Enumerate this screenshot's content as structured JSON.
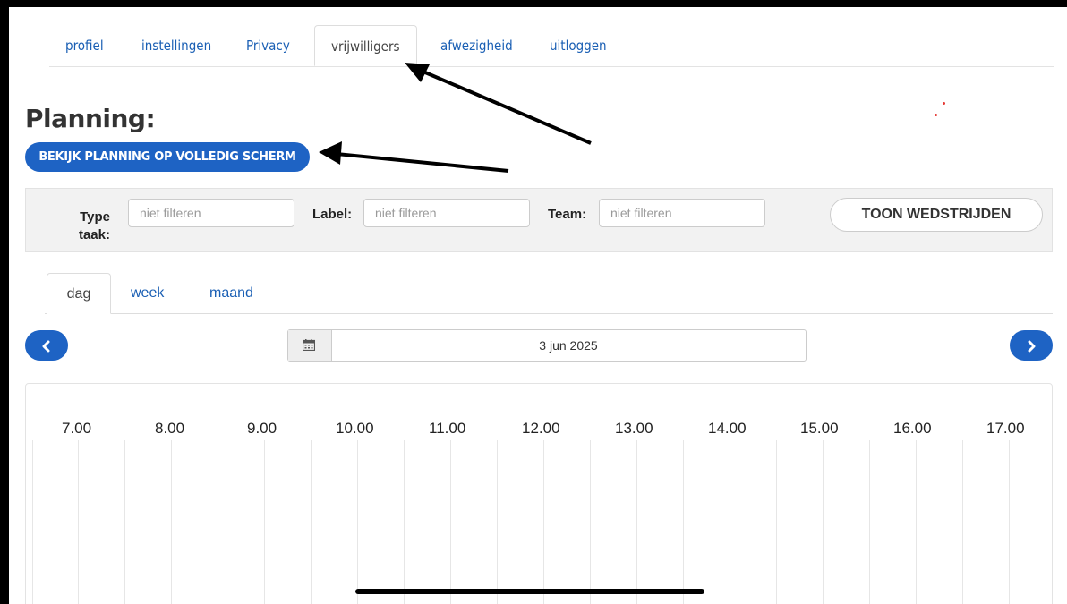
{
  "nav": {
    "tabs": [
      {
        "label": "profiel"
      },
      {
        "label": "instellingen"
      },
      {
        "label": "Privacy"
      },
      {
        "label": "vrijwilligers",
        "active": true
      },
      {
        "label": "afwezigheid"
      },
      {
        "label": "uitloggen"
      }
    ]
  },
  "page": {
    "title": "Planning:",
    "fullscreen_button": "BEKIJK PLANNING OP VOLLEDIG SCHERM"
  },
  "filters": {
    "type_label": "Type taak:",
    "type_placeholder": "niet filteren",
    "label_label": "Label:",
    "label_placeholder": "niet filteren",
    "team_label": "Team:",
    "team_placeholder": "niet filteren",
    "toggle_button": "TOON WEDSTRIJDEN"
  },
  "views": {
    "tabs": [
      {
        "label": "dag",
        "active": true
      },
      {
        "label": "week"
      },
      {
        "label": "maand"
      }
    ]
  },
  "date_nav": {
    "prev_icon": "chevron-left-icon",
    "next_icon": "chevron-right-icon",
    "calendar_icon": "calendar-icon",
    "date": "3 jun 2025"
  },
  "timeline": {
    "hours": [
      "7.00",
      "8.00",
      "9.00",
      "10.00",
      "11.00",
      "12.00",
      "13.00",
      "14.00",
      "15.00",
      "16.00",
      "17.00"
    ]
  },
  "colors": {
    "accent": "#1e63c4",
    "link": "#1a5fb4",
    "annotation_arrow": "#000000"
  }
}
